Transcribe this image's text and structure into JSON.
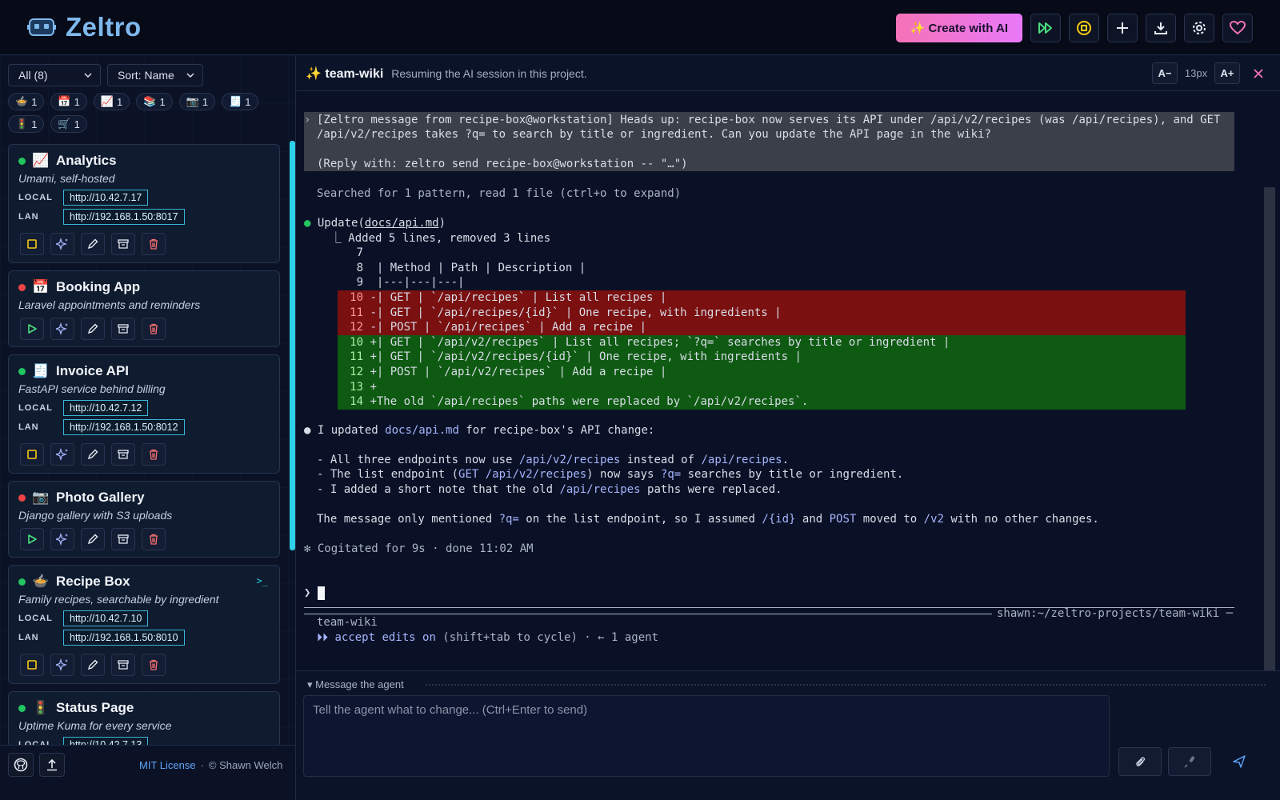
{
  "header": {
    "app_name": "Zeltro",
    "create_label": "✨ Create with AI",
    "colors": {
      "accent": "#7fb8ec",
      "create_gradient_start": "#f472b6",
      "create_gradient_end": "#e879f9"
    },
    "icons": [
      "run-all-icon",
      "stop-all-icon",
      "plus-icon",
      "download-icon",
      "gear-icon",
      "heart-icon"
    ]
  },
  "sidebar": {
    "filter_select": "All (8)",
    "sort_select": "Sort: Name",
    "tags": [
      {
        "emoji": "🍲",
        "count": "1"
      },
      {
        "emoji": "📅",
        "count": "1"
      },
      {
        "emoji": "📈",
        "count": "1"
      },
      {
        "emoji": "📚",
        "count": "1"
      },
      {
        "emoji": "📷",
        "count": "1"
      },
      {
        "emoji": "🧾",
        "count": "1"
      },
      {
        "emoji": "🚦",
        "count": "1"
      },
      {
        "emoji": "🛒",
        "count": "1"
      }
    ],
    "cards": [
      {
        "emoji": "📈",
        "name": "Analytics",
        "desc": "Umami, self-hosted",
        "status": "running",
        "local_label": "LOCAL",
        "local_url": "http://10.42.7.17",
        "lan_label": "LAN",
        "lan_url": "http://192.168.1.50:8017"
      },
      {
        "emoji": "📅",
        "name": "Booking App",
        "desc": "Laravel appointments and reminders",
        "status": "stopped"
      },
      {
        "emoji": "🧾",
        "name": "Invoice API",
        "desc": "FastAPI service behind billing",
        "status": "running",
        "local_label": "LOCAL",
        "local_url": "http://10.42.7.12",
        "lan_label": "LAN",
        "lan_url": "http://192.168.1.50:8012"
      },
      {
        "emoji": "📷",
        "name": "Photo Gallery",
        "desc": "Django gallery with S3 uploads",
        "status": "stopped"
      },
      {
        "emoji": "🍲",
        "name": "Recipe Box",
        "desc": "Family recipes, searchable by ingredient",
        "status": "running",
        "terminal_glyph": ">_",
        "local_label": "LOCAL",
        "local_url": "http://10.42.7.10",
        "lan_label": "LAN",
        "lan_url": "http://192.168.1.50:8010"
      },
      {
        "emoji": "🚦",
        "name": "Status Page",
        "desc": "Uptime Kuma for every service",
        "status": "running",
        "local_label": "LOCAL",
        "local_url": "http://10.42.7.13"
      }
    ],
    "footer": {
      "license": "MIT License",
      "separator": "·",
      "author": "© Shawn Welch"
    }
  },
  "panel": {
    "title": "✨ team-wiki",
    "subtitle": "Resuming the AI session in this project.",
    "font_decrease": "A−",
    "font_size": "13px",
    "font_increase": "A+"
  },
  "terminal": {
    "msg_marker": "›",
    "msg_line1": "[Zeltro message from recipe-box@workstation] Heads up: recipe-box now serves its API under /api/v2/recipes (was /api/recipes), and GET",
    "msg_line2": "/api/v2/recipes takes ?q= to search by title or ingredient. Can you update the API page in the wiki?",
    "msg_line3": "(Reply with: zeltro send recipe-box@workstation -- \"…\")",
    "searched": "Searched for 1 pattern, read 1 file (ctrl+o to expand)",
    "update_prefix": "Update(",
    "update_file": "docs/api.md",
    "update_suffix": ")",
    "added_line": "  ⎿ Added 5 lines, removed 3 lines",
    "diff_context": [
      {
        "num": "7",
        "text": ""
      },
      {
        "num": "8",
        "text": "| Method | Path | Description |"
      },
      {
        "num": "9",
        "text": "|---|---|---|"
      }
    ],
    "diff_removed": [
      {
        "num": "10",
        "text": "-| GET | `/api/recipes` | List all recipes |"
      },
      {
        "num": "11",
        "text": "-| GET | `/api/recipes/{id}` | One recipe, with ingredients |"
      },
      {
        "num": "12",
        "text": "-| POST | `/api/recipes` | Add a recipe |"
      }
    ],
    "diff_added": [
      {
        "num": "10",
        "text": "+| GET | `/api/v2/recipes` | List all recipes; `?q=` searches by title or ingredient |"
      },
      {
        "num": "11",
        "text": "+| GET | `/api/v2/recipes/{id}` | One recipe, with ingredients |"
      },
      {
        "num": "12",
        "text": "+| POST | `/api/v2/recipes` | Add a recipe |"
      },
      {
        "num": "13",
        "text": "+"
      },
      {
        "num": "14",
        "text": "+The old `/api/recipes` paths were replaced by `/api/v2/recipes`."
      }
    ],
    "summary_pre": "I updated ",
    "summary_file": "docs/api.md",
    "summary_post": " for recipe-box's API change:",
    "b1_pre": "- All three endpoints now use ",
    "b1_p1": "/api/v2/recipes",
    "b1_mid": " instead of ",
    "b1_p2": "/api/recipes",
    "b1_post": ".",
    "b2_pre": "- The list endpoint (",
    "b2_p": "GET /api/v2/recipes",
    "b2_mid": ") now says ",
    "b2_q": "?q=",
    "b2_post": " searches by title or ingredient.",
    "b3_pre": "- I added a short note that the old ",
    "b3_p": "/api/recipes",
    "b3_post": " paths were replaced.",
    "n_pre": "The message only mentioned ",
    "n_q": "?q=",
    "n_mid1": " on the list endpoint, so I assumed ",
    "n_id": "/{id}",
    "n_and": " and ",
    "n_post": "POST",
    "n_moved": " moved to ",
    "n_v2": "/v2",
    "n_end": " with no other changes.",
    "cogitated": "✻ Cogitated for 9s · done 11:02 AM",
    "prompt_path": "shawn:~/zeltro-projects/team-wiki ─",
    "prompt_char": "❯",
    "status_project": "team-wiki",
    "status_arrows": "⏵⏵",
    "status_mode": "accept edits on",
    "status_rest": " (shift+tab to cycle) · ← 1 agent"
  },
  "composer": {
    "title": "▾ Message the agent",
    "placeholder": "Tell the agent what to change...  (Ctrl+Enter to send)"
  }
}
